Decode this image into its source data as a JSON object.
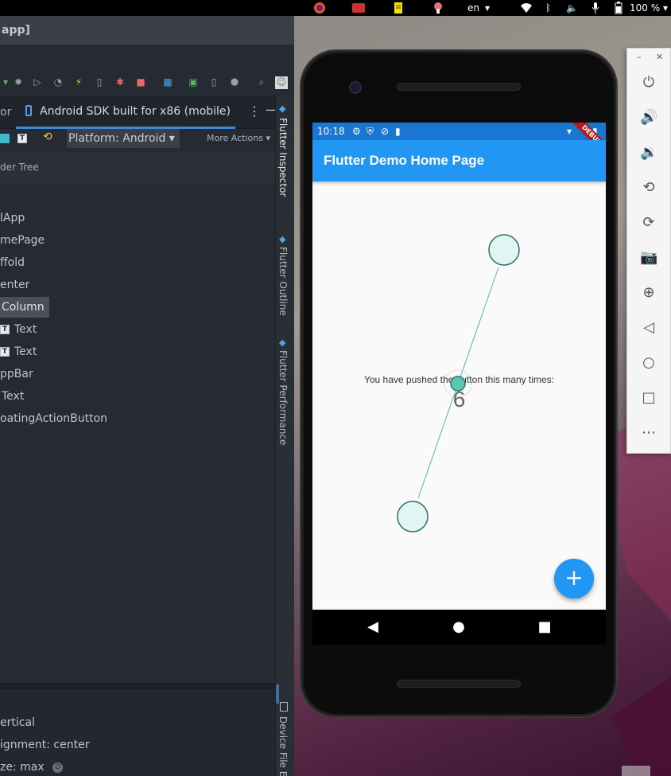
{
  "topbar": {
    "language": "en",
    "battery": "100 %"
  },
  "ide": {
    "window_title": "app]",
    "device_tab": "Android SDK built for x86 (mobile)",
    "left_tab_fragment": "or",
    "platform_selector": "Platform: Android",
    "more_actions": "More Actions",
    "tree_header": "der Tree",
    "tree_items": [
      "lApp",
      "mePage",
      "ffold",
      "enter",
      "Column",
      "Text",
      "Text",
      "ppBar",
      "Text",
      "oatingActionButton"
    ],
    "properties": [
      "ertical",
      "ignment: center",
      "ze: max"
    ],
    "side_tabs": [
      "Flutter Inspector",
      "Flutter Outline",
      "Flutter Performance",
      "Device File Explo"
    ]
  },
  "phone": {
    "status_time": "10:18",
    "appbar_title": "Flutter Demo Home Page",
    "debug_label": "DEBUG",
    "counter_label": "You have pushed the button this many times:",
    "counter_value": "6",
    "fab_label": "+"
  },
  "colors": {
    "appbar": "#2196f3",
    "statusbar": "#1976d2",
    "ide_bg": "#262b33",
    "accent_tab": "#3d8bd6",
    "multitouch": "#4fb6b0"
  }
}
